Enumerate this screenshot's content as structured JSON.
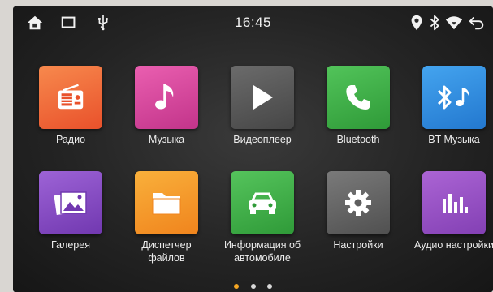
{
  "status_bar": {
    "time": "16:45",
    "left_icons": [
      "home-icon",
      "recent-apps-icon",
      "usb-icon"
    ],
    "right_icons": [
      "location-icon",
      "bluetooth-icon",
      "wifi-icon",
      "back-icon"
    ]
  },
  "apps": [
    {
      "label": "Радио",
      "icon": "radio-icon",
      "color": "#f06a3a"
    },
    {
      "label": "Музыка",
      "icon": "music-note-icon",
      "color": "#d8479a"
    },
    {
      "label": "Видеоплеер",
      "icon": "play-icon",
      "color": "#5a5a5a"
    },
    {
      "label": "Bluetooth",
      "icon": "phone-icon",
      "color": "#3dae46"
    },
    {
      "label": "BT Музыка",
      "icon": "bluetooth-music-icon",
      "color": "#2f8fe0"
    },
    {
      "label": "Галерея",
      "icon": "gallery-icon",
      "color": "#8a4fc7"
    },
    {
      "label": "Диспетчер файлов",
      "icon": "folder-icon",
      "color": "#f59a2a"
    },
    {
      "label": "Информация об автомобиле",
      "icon": "car-icon",
      "color": "#42ad4a"
    },
    {
      "label": "Настройки",
      "icon": "settings-gear-icon",
      "color": "#6b6b6b"
    },
    {
      "label": "Аудио настройки",
      "icon": "equalizer-icon",
      "color": "#9a52c4"
    }
  ],
  "page_indicator": {
    "pages": 3,
    "current": 1
  }
}
